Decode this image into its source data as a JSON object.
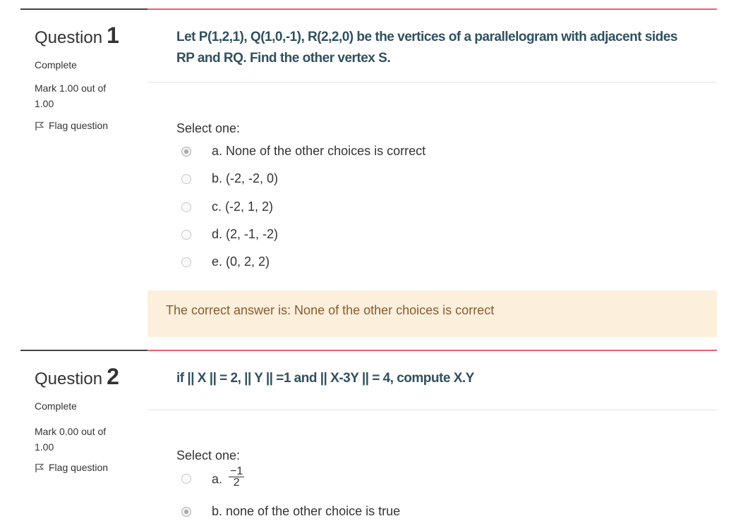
{
  "questions": [
    {
      "label": "Question",
      "number": "1",
      "state": "Complete",
      "grade": "Mark 1.00 out of 1.00",
      "flag": "Flag question",
      "text": "Let P(1,2,1), Q(1,0,-1), R(2,2,0) be the vertices of a parallelogram with adjacent sides RP and RQ. Find the other vertex S.",
      "select_prompt": "Select one:",
      "options": [
        {
          "label": "a. None of the other choices is correct",
          "selected": true
        },
        {
          "label": "b. (-2, -2, 0)",
          "selected": false
        },
        {
          "label": "c. (-2, 1, 2)",
          "selected": false
        },
        {
          "label": "d. (2, -1, -2)",
          "selected": false
        },
        {
          "label": "e. (0, 2, 2)",
          "selected": false
        }
      ],
      "feedback": "The correct answer is: None of the other choices is correct"
    },
    {
      "label": "Question",
      "number": "2",
      "state": "Complete",
      "grade": "Mark 0.00 out of 1.00",
      "flag": "Flag question",
      "text": "if || X || = 2, || Y || =1 and || X-3Y || = 4, compute X.Y",
      "select_prompt": "Select one:",
      "options": [
        {
          "prefix": "a.",
          "numerator": "−1",
          "denominator": "2",
          "selected": false
        },
        {
          "label": "b. none of the other choice is true",
          "selected": true
        }
      ]
    }
  ],
  "colors": {
    "accent_border": "#e4656f",
    "question_text": "#30505f",
    "feedback_bg": "#fcefdc",
    "feedback_text": "#8a5b2e"
  },
  "icons": {
    "flag": "flag-icon"
  }
}
